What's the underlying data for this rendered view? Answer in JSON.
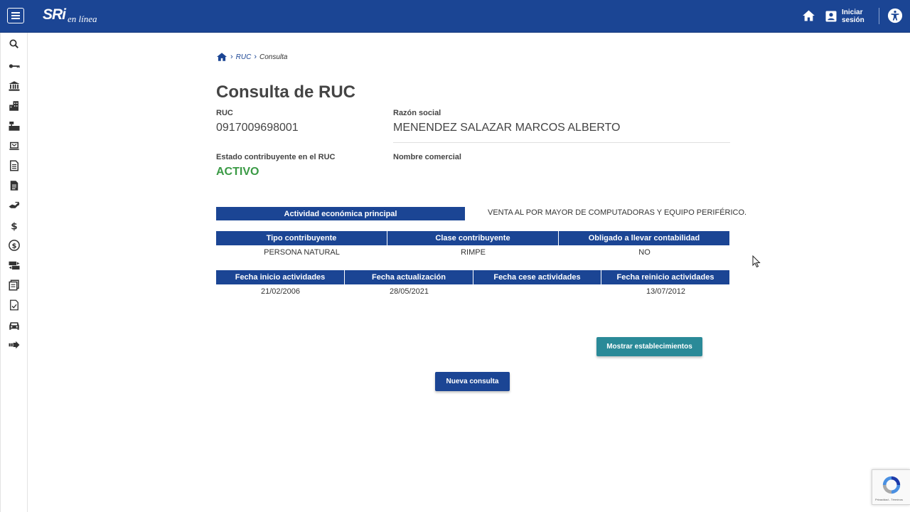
{
  "header": {
    "logo_main": "SRi",
    "logo_sub": "en línea",
    "login_label": "Iniciar sesión"
  },
  "breadcrumb": {
    "link": "RUC",
    "current": "Consulta"
  },
  "page_title": "Consulta de RUC",
  "ruc": {
    "label": "RUC",
    "value": "0917009698001"
  },
  "razon_social": {
    "label": "Razón social",
    "value": "MENENDEZ SALAZAR MARCOS ALBERTO"
  },
  "estado": {
    "label": "Estado contribuyente en el RUC",
    "value": "ACTIVO"
  },
  "nombre_comercial": {
    "label": "Nombre comercial",
    "value": ""
  },
  "actividad": {
    "label": "Actividad económica principal",
    "value": "VENTA AL POR MAYOR DE COMPUTADORAS Y EQUIPO PERIFÉRICO."
  },
  "table_contribuyente": {
    "headers": [
      "Tipo contribuyente",
      "Clase contribuyente",
      "Obligado a llevar contabilidad"
    ],
    "row": [
      "PERSONA NATURAL",
      "RIMPE",
      "NO"
    ]
  },
  "table_fechas": {
    "headers": [
      "Fecha inicio actividades",
      "Fecha actualización",
      "Fecha cese actividades",
      "Fecha reinicio actividades"
    ],
    "row": [
      "21/02/2006",
      "28/05/2021",
      "",
      "13/07/2012"
    ]
  },
  "buttons": {
    "mostrar": "Mostrar establecimientos",
    "nueva": "Nueva consulta"
  },
  "recaptcha_text": "Privacidad - Términos",
  "colors": {
    "primary": "#1b4594",
    "teal": "#2a8a98",
    "status_green": "#3a9a45"
  },
  "sidebar_icons": [
    "search-icon",
    "key-icon",
    "bank-icon",
    "buildings-icon",
    "cash-register-icon",
    "laptop-icon",
    "document-lines-icon",
    "document-icon",
    "hand-tag-icon",
    "dollar-icon",
    "dollar-circle-icon",
    "money-transfer-icon",
    "receipt-icon",
    "document-check-icon",
    "car-icon",
    "arrow-right-icon"
  ]
}
